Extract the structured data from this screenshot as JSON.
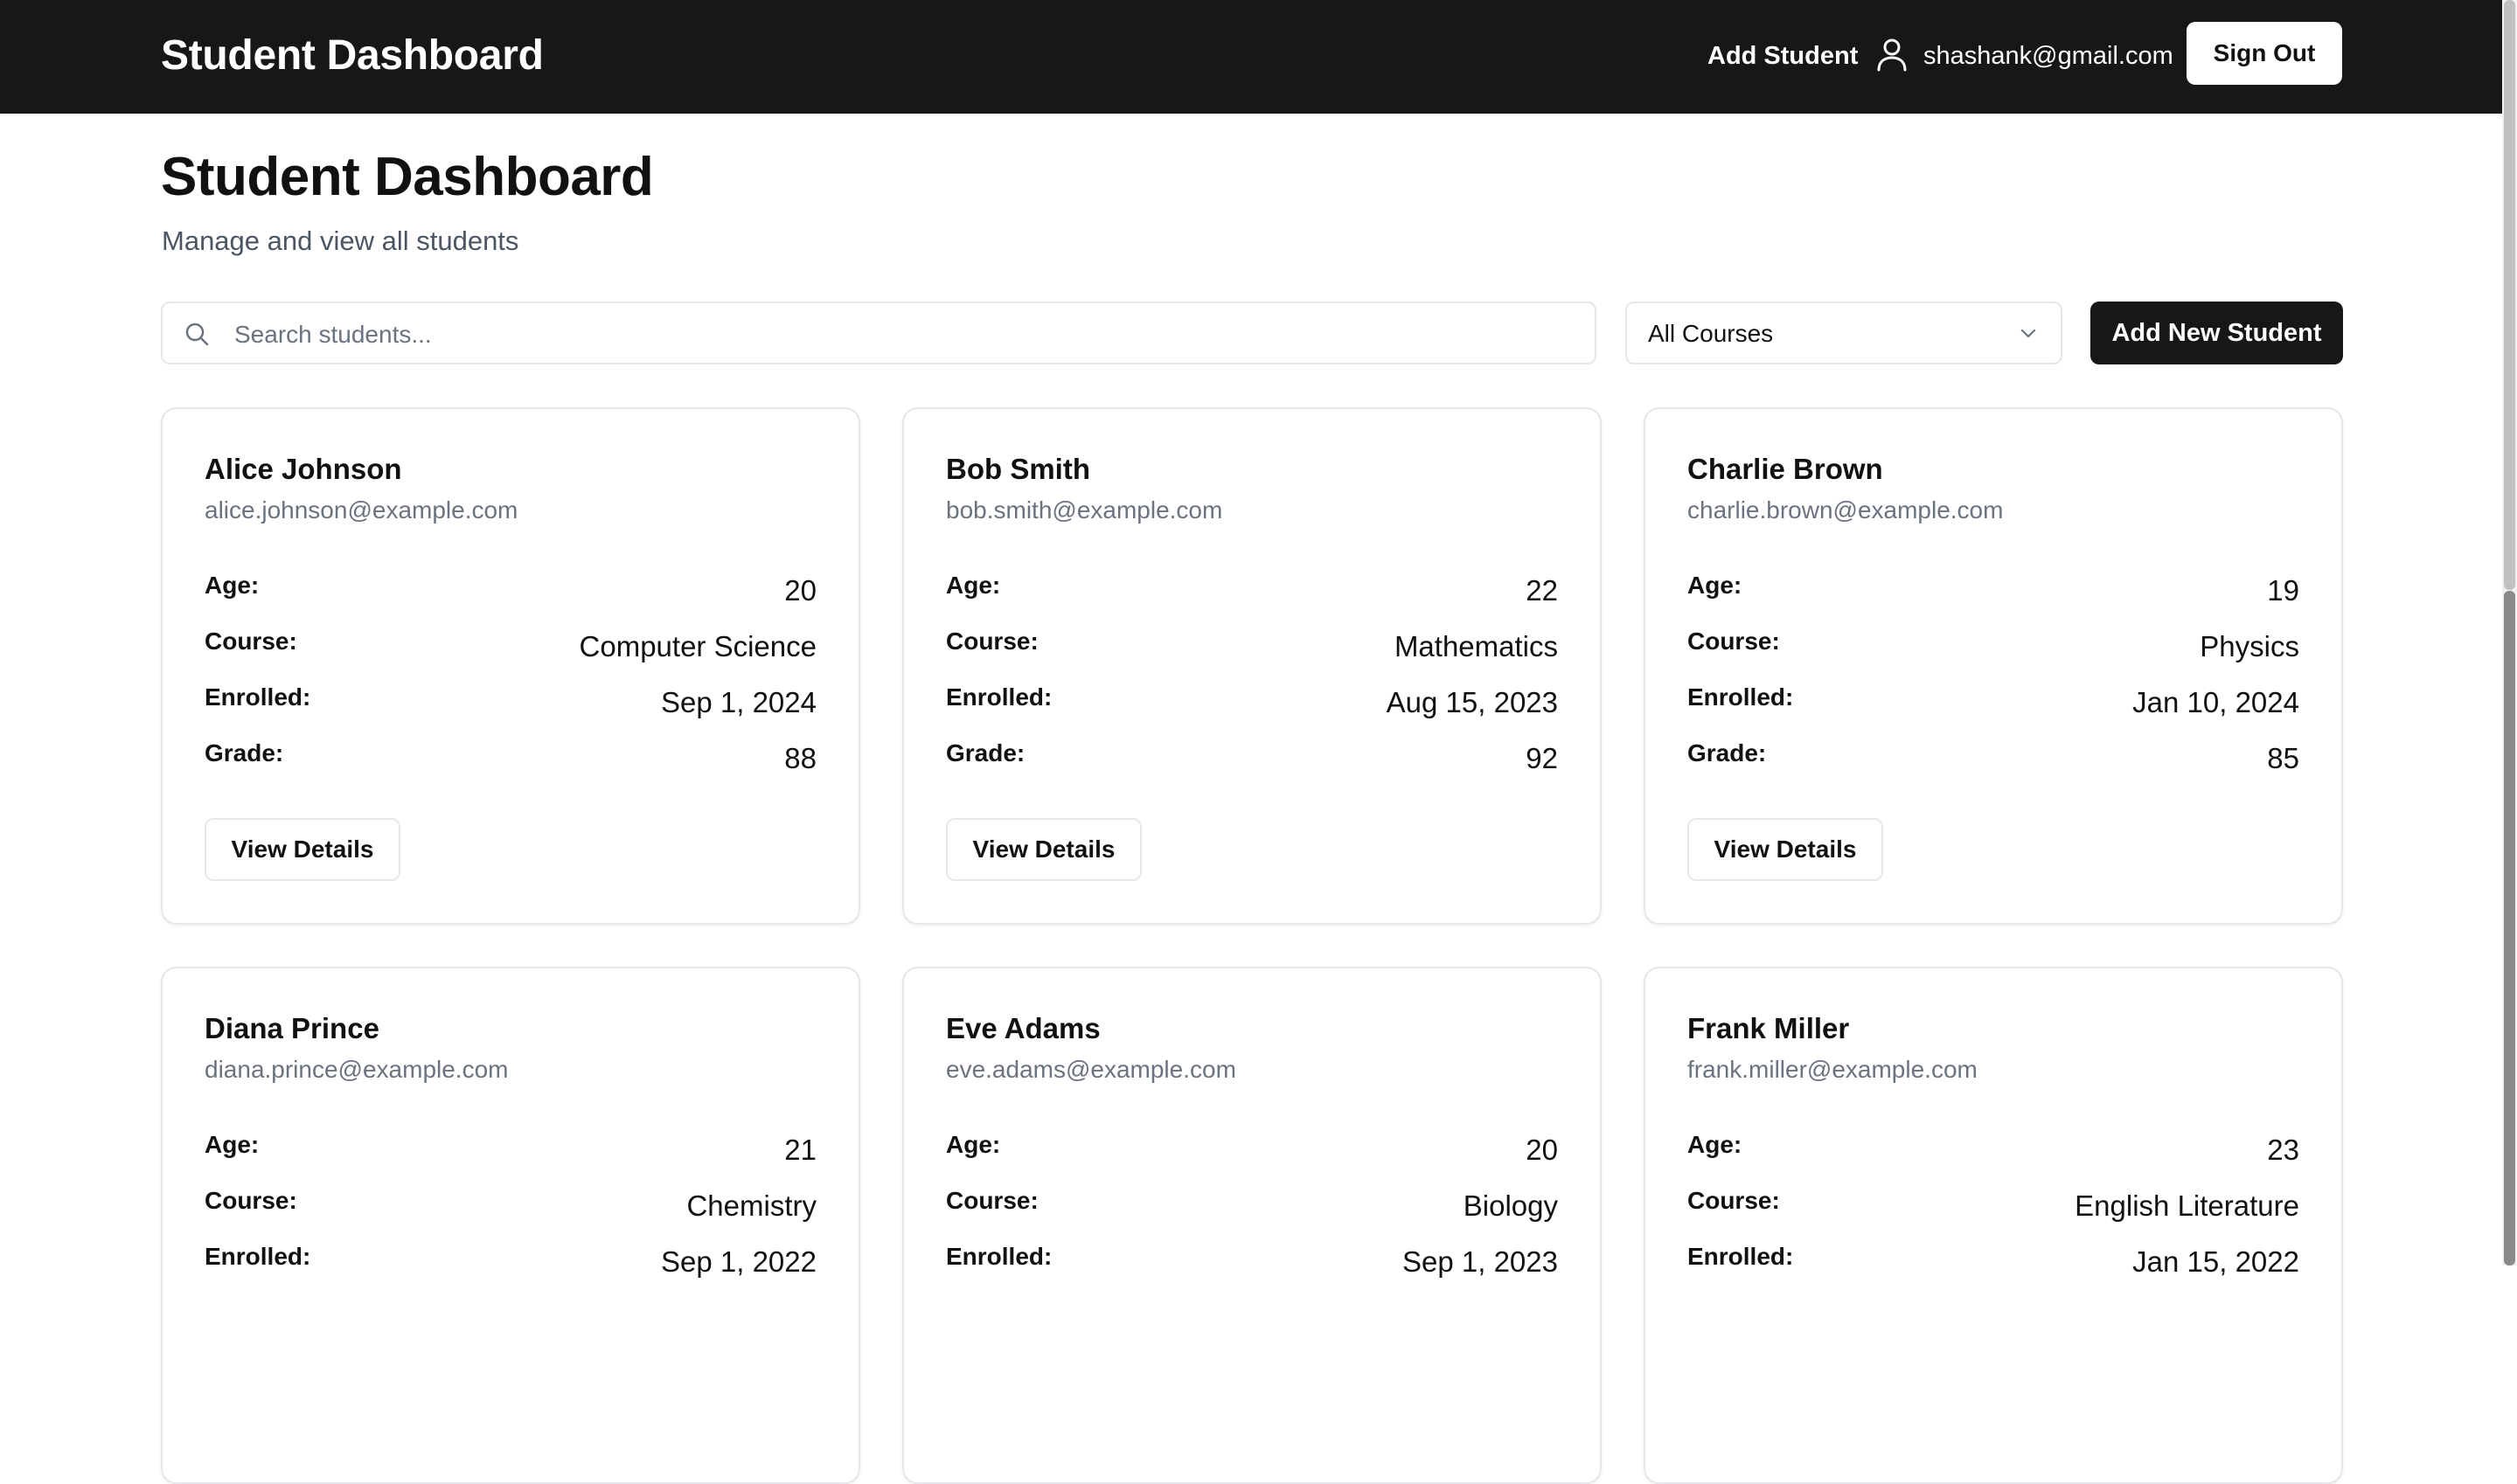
{
  "header": {
    "brand": "Student Dashboard",
    "add_student": "Add Student",
    "user_email": "shashank@gmail.com",
    "sign_out": "Sign Out"
  },
  "page": {
    "title": "Student Dashboard",
    "subtitle": "Manage and view all students"
  },
  "toolbar": {
    "search_placeholder": "Search students...",
    "course_filter": "All Courses",
    "add_new": "Add New Student"
  },
  "labels": {
    "age": "Age:",
    "course": "Course:",
    "enrolled": "Enrolled:",
    "grade": "Grade:",
    "view_details": "View Details"
  },
  "students": [
    {
      "name": "Alice Johnson",
      "email": "alice.johnson@example.com",
      "age": "20",
      "course": "Computer Science",
      "enrolled": "Sep 1, 2024",
      "grade": "88"
    },
    {
      "name": "Bob Smith",
      "email": "bob.smith@example.com",
      "age": "22",
      "course": "Mathematics",
      "enrolled": "Aug 15, 2023",
      "grade": "92"
    },
    {
      "name": "Charlie Brown",
      "email": "charlie.brown@example.com",
      "age": "19",
      "course": "Physics",
      "enrolled": "Jan 10, 2024",
      "grade": "85"
    },
    {
      "name": "Diana Prince",
      "email": "diana.prince@example.com",
      "age": "21",
      "course": "Chemistry",
      "enrolled": "Sep 1, 2022",
      "grade": ""
    },
    {
      "name": "Eve Adams",
      "email": "eve.adams@example.com",
      "age": "20",
      "course": "Biology",
      "enrolled": "Sep 1, 2023",
      "grade": ""
    },
    {
      "name": "Frank Miller",
      "email": "frank.miller@example.com",
      "age": "23",
      "course": "English Literature",
      "enrolled": "Jan 15, 2022",
      "grade": ""
    }
  ],
  "colors": {
    "topbar_bg": "#171717",
    "primary_button": "#171717",
    "muted_text": "#6b7280",
    "border": "#e5e7eb"
  },
  "icons": {
    "user": "user-icon",
    "search": "search-icon",
    "dropdown": "chevron-down-icon"
  }
}
